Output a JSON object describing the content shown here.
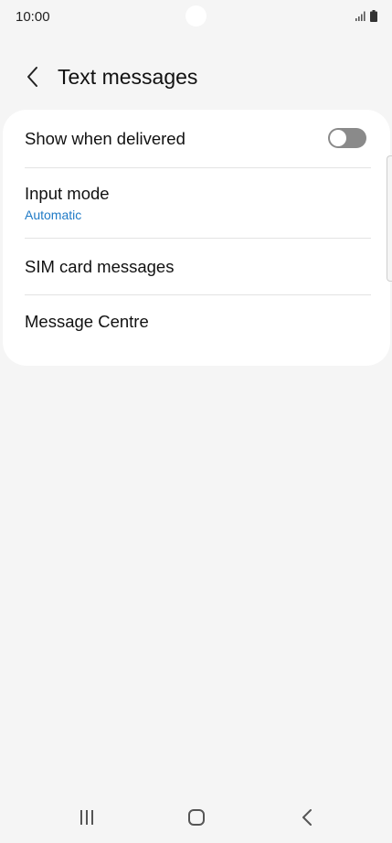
{
  "status_bar": {
    "time": "10:00"
  },
  "header": {
    "title": "Text messages"
  },
  "settings": {
    "show_when_delivered": {
      "label": "Show when delivered",
      "toggle_state": "off"
    },
    "input_mode": {
      "label": "Input mode",
      "value": "Automatic"
    },
    "sim_card_messages": {
      "label": "SIM card messages"
    },
    "message_centre": {
      "label": "Message Centre"
    }
  },
  "colors": {
    "background": "#f5f5f5",
    "card": "#ffffff",
    "accent_text": "#1f7ac6",
    "toggle_off": "#8a8a8a"
  }
}
